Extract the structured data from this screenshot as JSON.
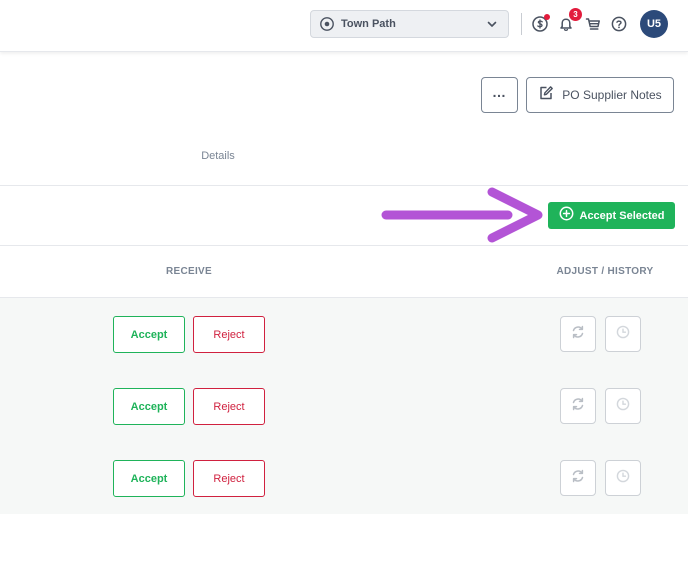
{
  "header": {
    "location_value": "Town Path",
    "notification_count": "3",
    "avatar_initials": "U5"
  },
  "actions": {
    "more_label": "…",
    "supplier_notes_label": "PO Supplier Notes"
  },
  "section": {
    "details_label": "Details",
    "accept_selected_label": "Accept Selected"
  },
  "table": {
    "columns": {
      "receive": "RECEIVE",
      "adjust_history": "ADJUST / HISTORY"
    },
    "rows": [
      {
        "accept_label": "Accept",
        "reject_label": "Reject"
      },
      {
        "accept_label": "Accept",
        "reject_label": "Reject"
      },
      {
        "accept_label": "Accept",
        "reject_label": "Reject"
      }
    ]
  },
  "colors": {
    "accent_green": "#1fb35a",
    "reject_red": "#d0213f",
    "annotation_arrow": "#b354d6",
    "avatar_bg": "#2c4a7a"
  },
  "icons": [
    "location-pin-icon",
    "chevron-down-icon",
    "cash-icon",
    "bell-icon",
    "cart-icon",
    "help-icon",
    "more-icon",
    "edit-icon",
    "plus-circle-icon",
    "refresh-icon",
    "clock-icon"
  ]
}
